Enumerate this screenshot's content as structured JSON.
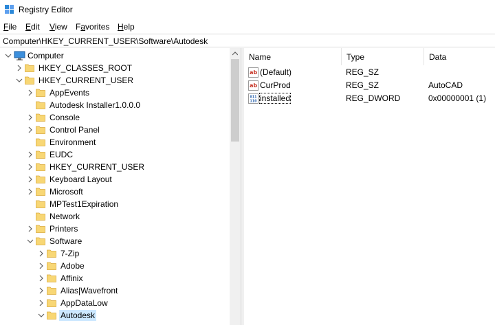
{
  "window": {
    "title": "Registry Editor"
  },
  "menu": [
    {
      "label": "File",
      "key": "F"
    },
    {
      "label": "Edit",
      "key": "E"
    },
    {
      "label": "View",
      "key": "V"
    },
    {
      "label": "Favorites",
      "key": "a"
    },
    {
      "label": "Help",
      "key": "H"
    }
  ],
  "address": "Computer\\HKEY_CURRENT_USER\\Software\\Autodesk",
  "tree": [
    {
      "label": "Computer",
      "expander": "expanded",
      "icon": "computer-icon"
    },
    {
      "label": "HKEY_CLASSES_ROOT",
      "expander": "collapsed",
      "icon": "folder-icon"
    },
    {
      "label": "HKEY_CURRENT_USER",
      "expander": "expanded",
      "icon": "folder-icon"
    },
    {
      "label": "AppEvents",
      "expander": "collapsed",
      "icon": "folder-icon"
    },
    {
      "label": "Autodesk Installer1.0.0.0",
      "expander": "none",
      "icon": "folder-icon"
    },
    {
      "label": "Console",
      "expander": "collapsed",
      "icon": "folder-icon"
    },
    {
      "label": "Control Panel",
      "expander": "collapsed",
      "icon": "folder-icon"
    },
    {
      "label": "Environment",
      "expander": "none",
      "icon": "folder-icon"
    },
    {
      "label": "EUDC",
      "expander": "collapsed",
      "icon": "folder-icon"
    },
    {
      "label": "HKEY_CURRENT_USER",
      "expander": "collapsed",
      "icon": "folder-icon"
    },
    {
      "label": "Keyboard Layout",
      "expander": "collapsed",
      "icon": "folder-icon"
    },
    {
      "label": "Microsoft",
      "expander": "collapsed",
      "icon": "folder-icon"
    },
    {
      "label": "MPTest1Expiration",
      "expander": "none",
      "icon": "folder-icon"
    },
    {
      "label": "Network",
      "expander": "none",
      "icon": "folder-icon"
    },
    {
      "label": "Printers",
      "expander": "collapsed",
      "icon": "folder-icon"
    },
    {
      "label": "Software",
      "expander": "expanded",
      "icon": "folder-icon"
    },
    {
      "label": "7-Zip",
      "expander": "collapsed",
      "icon": "folder-icon"
    },
    {
      "label": "Adobe",
      "expander": "collapsed",
      "icon": "folder-icon"
    },
    {
      "label": "Affinix",
      "expander": "collapsed",
      "icon": "folder-icon"
    },
    {
      "label": "Alias|Wavefront",
      "expander": "collapsed",
      "icon": "folder-icon"
    },
    {
      "label": "AppDataLow",
      "expander": "collapsed",
      "icon": "folder-icon"
    },
    {
      "label": "Autodesk",
      "expander": "expanded",
      "icon": "folder-icon",
      "selected": true
    }
  ],
  "list": {
    "columns": [
      "Name",
      "Type",
      "Data"
    ],
    "rows": [
      {
        "name": "(Default)",
        "type": "REG_SZ",
        "data": "",
        "icon": "string-value-icon"
      },
      {
        "name": "CurProd",
        "type": "REG_SZ",
        "data": "AutoCAD",
        "icon": "string-value-icon"
      },
      {
        "name": "installed",
        "type": "REG_DWORD",
        "data": "0x00000001 (1)",
        "icon": "binary-value-icon",
        "focused": true
      }
    ]
  },
  "colors": {
    "folder": "#f8d775",
    "selection": "#cce8ff",
    "accent": "#0078d7",
    "string_icon": "#c42b1c",
    "binary_icon": "#1e5aa8"
  }
}
